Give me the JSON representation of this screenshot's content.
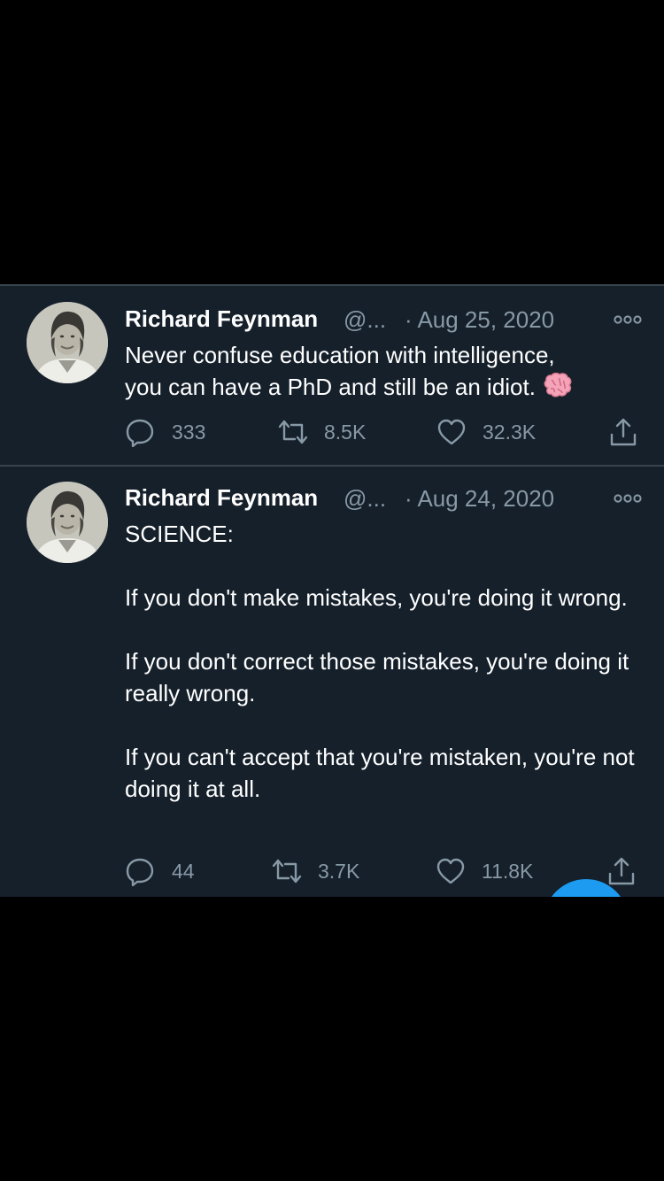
{
  "tweets": [
    {
      "author_name": "Richard Feynman",
      "handle": "@...",
      "date": "· Aug 25, 2020",
      "text_lines": [
        "Never confuse education with intelligence,",
        "you can have a PhD and still be an idiot."
      ],
      "emoji": "brain-emoji",
      "replies": "333",
      "retweets": "8.5K",
      "likes": "32.3K"
    },
    {
      "author_name": "Richard Feynman",
      "handle": "@...",
      "date": "· Aug 24, 2020",
      "text_paragraphs": [
        "SCIENCE:",
        "If you don't make mistakes, you're doing it wrong.",
        "If you don't correct those mistakes, you're doing it really wrong.",
        "If you can't accept that you're mistaken, you're not doing it at all."
      ],
      "replies": "44",
      "retweets": "3.7K",
      "likes": "11.8K"
    }
  ],
  "icons": {
    "reply": "reply-icon",
    "retweet": "retweet-icon",
    "like": "heart-icon",
    "share": "share-icon",
    "more": "more-options-icon"
  },
  "colors": {
    "background": "#15202b",
    "divider": "#38444d",
    "text_primary": "#ffffff",
    "text_secondary": "#8899a6",
    "accent": "#1d9bf0"
  }
}
